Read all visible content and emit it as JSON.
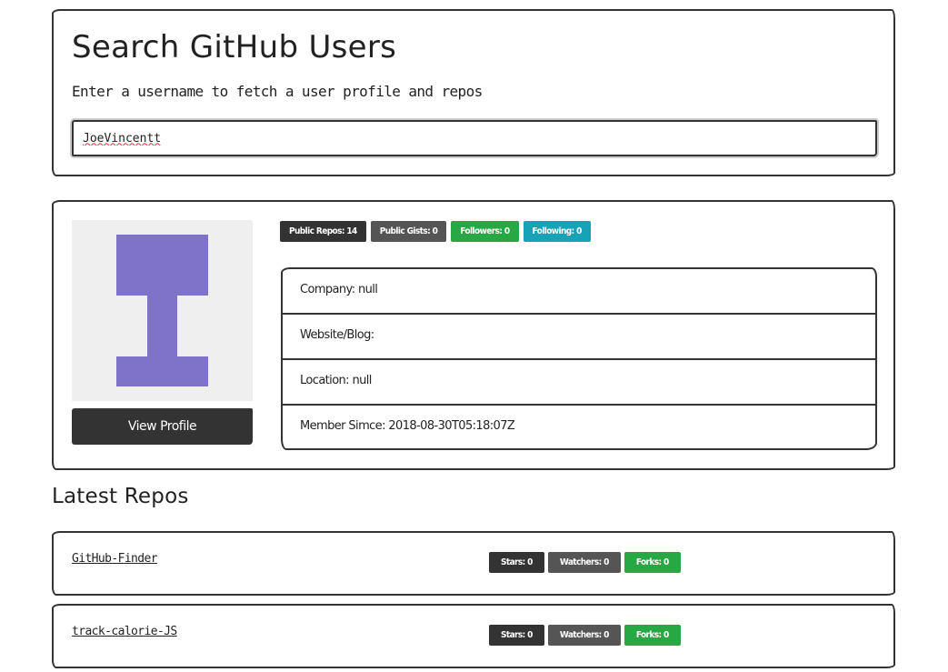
{
  "search": {
    "title": "Search GitHub Users",
    "subtitle": "Enter a username to fetch a user profile and repos",
    "value": "JoeVincentt"
  },
  "profile": {
    "view_profile_label": "View Profile",
    "badges": {
      "public_repos": "Public Repos: 14",
      "public_gists": "Public Gists: 0",
      "followers": "Followers: 0",
      "following": "Following: 0"
    },
    "info": {
      "company": "Company: null",
      "website": "Website/Blog:",
      "location": "Location: null",
      "member_since": "Member Simce: 2018-08-30T05:18:07Z"
    },
    "avatar_color": "#7f73c8"
  },
  "repos": {
    "heading": "Latest Repos",
    "items": [
      {
        "name": "GitHub-Finder",
        "stars": "Stars: 0",
        "watchers": "Watchers: 0",
        "forks": "Forks: 0"
      },
      {
        "name": "track-calorie-JS",
        "stars": "Stars: 0",
        "watchers": "Watchers: 0",
        "forks": "Forks: 0"
      }
    ]
  },
  "colors": {
    "dark": "#333333",
    "secondary": "#555555",
    "success": "#28a745",
    "info": "#17a2b8"
  }
}
